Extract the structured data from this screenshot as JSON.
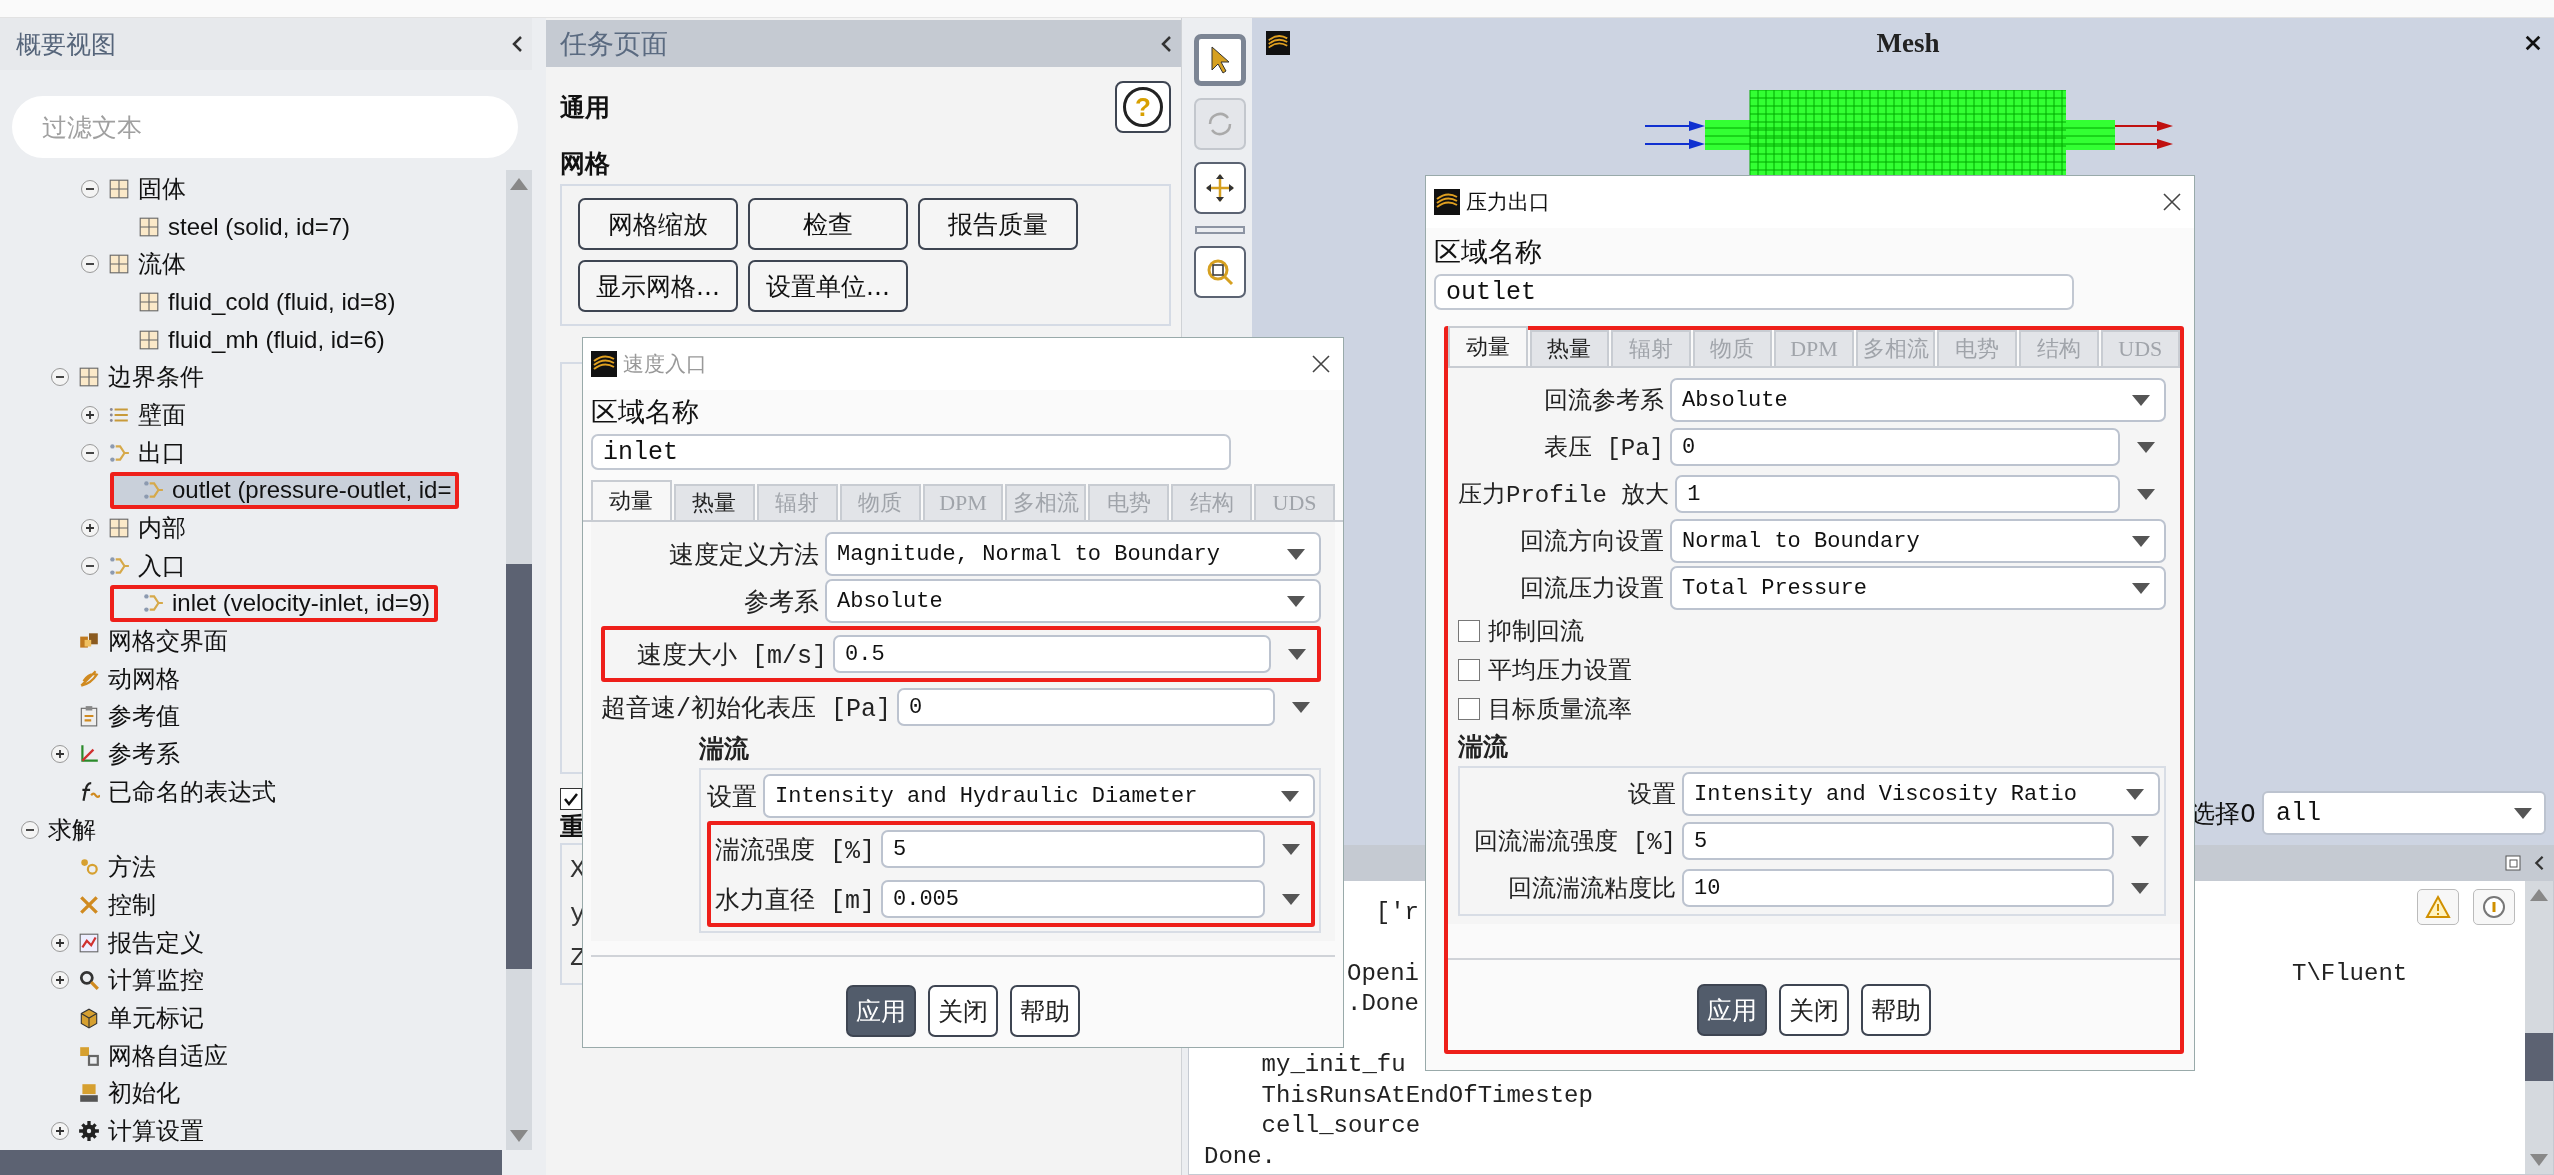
{
  "outline": {
    "title": "概要视图",
    "filter": {
      "placeholder": "过滤文本"
    },
    "tree": [
      {
        "children": [
          {
            "children": [
              {
                "label": "固体",
                "kind": "grid",
                "expanded": true,
                "selected": false,
                "children": [
                  {
                    "label": "steel (solid, id=7)",
                    "kind": "grid",
                    "selected": false
                  }
                ]
              },
              {
                "label": "流体",
                "kind": "grid",
                "expanded": true,
                "selected": false,
                "children": [
                  {
                    "label": "fluid_cold (fluid, id=8)",
                    "kind": "grid",
                    "selected": false
                  },
                  {
                    "label": "fluid_mh (fluid, id=6)",
                    "kind": "grid",
                    "selected": false
                  }
                ]
              }
            ]
          },
          {
            "label": "边界条件",
            "kind": "grid",
            "expanded": true,
            "selected": false,
            "children": [
              {
                "label": "壁面",
                "kind": "lines",
                "expanded": false,
                "selected": false
              },
              {
                "label": "出口",
                "kind": "branch",
                "expanded": true,
                "selected": false,
                "children": [
                  {
                    "label": "outlet (pressure-outlet, id=",
                    "kind": "branch",
                    "selected": true,
                    "annotated": true
                  }
                ]
              },
              {
                "label": "内部",
                "kind": "grid",
                "expanded": false,
                "selected": false
              },
              {
                "label": "入口",
                "kind": "branch",
                "expanded": true,
                "selected": false,
                "children": [
                  {
                    "label": "inlet (velocity-inlet, id=9)",
                    "kind": "branch",
                    "selected": false,
                    "annotated": true
                  }
                ]
              }
            ]
          },
          {
            "label": "网格交界面",
            "kind": "blocks",
            "selected": false
          },
          {
            "label": "动网格",
            "kind": "swirl",
            "selected": false
          },
          {
            "label": "参考值",
            "kind": "clipboard",
            "selected": false
          },
          {
            "label": "参考系",
            "kind": "axes",
            "expanded": false,
            "selected": false
          },
          {
            "label": "已命名的表达式",
            "kind": "curve",
            "selected": false
          }
        ]
      },
      {
        "label": "求解",
        "expanded": true,
        "selected": false,
        "children": [
          {
            "label": "方法",
            "kind": "dots",
            "selected": false
          },
          {
            "label": "控制",
            "kind": "cross",
            "selected": false
          },
          {
            "label": "报告定义",
            "kind": "chart",
            "expanded": false,
            "selected": false
          },
          {
            "label": "计算监控",
            "kind": "magnifier",
            "expanded": false,
            "selected": false
          },
          {
            "label": "单元标记",
            "kind": "cube",
            "selected": false
          },
          {
            "label": "网格自适应",
            "kind": "adapt",
            "selected": false
          },
          {
            "label": "初始化",
            "kind": "init",
            "selected": false
          },
          {
            "label": "计算设置",
            "kind": "gear",
            "expanded": false,
            "selected": false
          }
        ]
      }
    ]
  },
  "task_page": {
    "title": "任务页面",
    "section": "通用",
    "help_button": "?",
    "mesh": {
      "title": "网格",
      "buttons": [
        "网格缩放",
        "检查",
        "报告质量",
        "显示网格...",
        "设置单位..."
      ]
    },
    "gravity_checked": true,
    "section_3_title": "重",
    "axes": [
      "X",
      "y",
      "Z"
    ]
  },
  "toolbar": [
    {
      "kind": "pointer",
      "selected": true,
      "disabled": false
    },
    {
      "kind": "rotate",
      "selected": false,
      "disabled": true
    },
    {
      "kind": "move",
      "selected": false,
      "disabled": false
    },
    {
      "kind": "zoom",
      "selected": false,
      "disabled": false
    }
  ],
  "graphics": {
    "title": "Mesh",
    "selection_label": "选择0",
    "selection_value": "all"
  },
  "console": {
    "lines": [
      {
        "kind": "cut",
        "text": "  ['r"
      },
      {
        "kind": "blank"
      },
      {
        "kind": "cut",
        "text": "Openi",
        "tail": "T\\Fluent"
      },
      {
        "kind": "cut",
        "text": ".Done"
      },
      {
        "kind": "blank"
      },
      {
        "kind": "full",
        "text": "    my_init_fu"
      },
      {
        "kind": "full",
        "text": "    ThisRunsAtEndOfTimestep"
      },
      {
        "kind": "full",
        "text": "    cell_source"
      },
      {
        "kind": "full",
        "text": "Done."
      }
    ]
  },
  "inlet_dialog": {
    "title": "速度入口",
    "active": false,
    "annotated": false,
    "zone_label": "区域名称",
    "zone_name": "inlet",
    "tabs": [
      {
        "label": "动量",
        "selected": true,
        "disabled": false
      },
      {
        "label": "热量",
        "selected": false,
        "disabled": false
      },
      {
        "label": "辐射",
        "selected": false,
        "disabled": true
      },
      {
        "label": "物质",
        "selected": false,
        "disabled": true
      },
      {
        "label": "DPM",
        "selected": false,
        "disabled": true
      },
      {
        "label": "多相流",
        "selected": false,
        "disabled": true
      },
      {
        "label": "电势",
        "selected": false,
        "disabled": true
      },
      {
        "label": "结构",
        "selected": false,
        "disabled": true
      },
      {
        "label": "UDS",
        "selected": false,
        "disabled": true
      }
    ],
    "rows": [
      {
        "kind": "dropdown",
        "label": "速度定义方法",
        "value": "Magnitude, Normal to Boundary"
      },
      {
        "kind": "dropdown",
        "label": "参考系",
        "value": "Absolute"
      },
      {
        "kind": "input",
        "label": "速度大小 [m/s]",
        "value": "0.5",
        "annotated": true
      },
      {
        "kind": "input",
        "label": "超音速/初始化表压 [Pa]",
        "value": "0"
      }
    ],
    "turbulence": {
      "title": "湍流",
      "rows": [
        {
          "kind": "dropdown",
          "label": "设置",
          "value": "Intensity and Hydraulic Diameter"
        },
        {
          "kind": "input",
          "label": "湍流强度 [%]",
          "value": "5",
          "annotated": true
        },
        {
          "kind": "input",
          "label": "水力直径 [m]",
          "value": "0.005",
          "annotated": true
        }
      ]
    },
    "buttons": [
      {
        "label": "应用",
        "primary": true
      },
      {
        "label": "关闭",
        "primary": false
      },
      {
        "label": "帮助",
        "primary": false
      }
    ]
  },
  "outlet_dialog": {
    "title": "压力出口",
    "active": true,
    "annotated": true,
    "zone_label": "区域名称",
    "zone_name": "outlet",
    "tabs": [
      {
        "label": "动量",
        "selected": true,
        "disabled": false
      },
      {
        "label": "热量",
        "selected": false,
        "disabled": false
      },
      {
        "label": "辐射",
        "selected": false,
        "disabled": true
      },
      {
        "label": "物质",
        "selected": false,
        "disabled": true
      },
      {
        "label": "DPM",
        "selected": false,
        "disabled": true
      },
      {
        "label": "多相流",
        "selected": false,
        "disabled": true
      },
      {
        "label": "电势",
        "selected": false,
        "disabled": true
      },
      {
        "label": "结构",
        "selected": false,
        "disabled": true
      },
      {
        "label": "UDS",
        "selected": false,
        "disabled": true
      }
    ],
    "rows": [
      {
        "kind": "dropdown",
        "label": "回流参考系",
        "value": "Absolute"
      },
      {
        "kind": "input",
        "label": "表压 [Pa]",
        "value": "0"
      },
      {
        "kind": "input",
        "label": "压力Profile 放大",
        "value": "1"
      },
      {
        "kind": "dropdown",
        "label": "回流方向设置",
        "value": "Normal to Boundary"
      },
      {
        "kind": "dropdown",
        "label": "回流压力设置",
        "value": "Total Pressure"
      },
      {
        "kind": "checkbox",
        "label": "抑制回流",
        "checked": false
      },
      {
        "kind": "checkbox",
        "label": "平均压力设置",
        "checked": false
      },
      {
        "kind": "checkbox",
        "label": "目标质量流率",
        "checked": false
      }
    ],
    "turbulence": {
      "title": "湍流",
      "rows": [
        {
          "kind": "dropdown",
          "label": "设置",
          "value": "Intensity and Viscosity Ratio"
        },
        {
          "kind": "input",
          "label": "回流湍流强度 [%]",
          "value": "5"
        },
        {
          "kind": "input",
          "label": "回流湍流粘度比",
          "value": "10"
        }
      ]
    },
    "buttons": [
      {
        "label": "应用",
        "primary": true
      },
      {
        "label": "关闭",
        "primary": false
      },
      {
        "label": "帮助",
        "primary": false
      }
    ]
  }
}
